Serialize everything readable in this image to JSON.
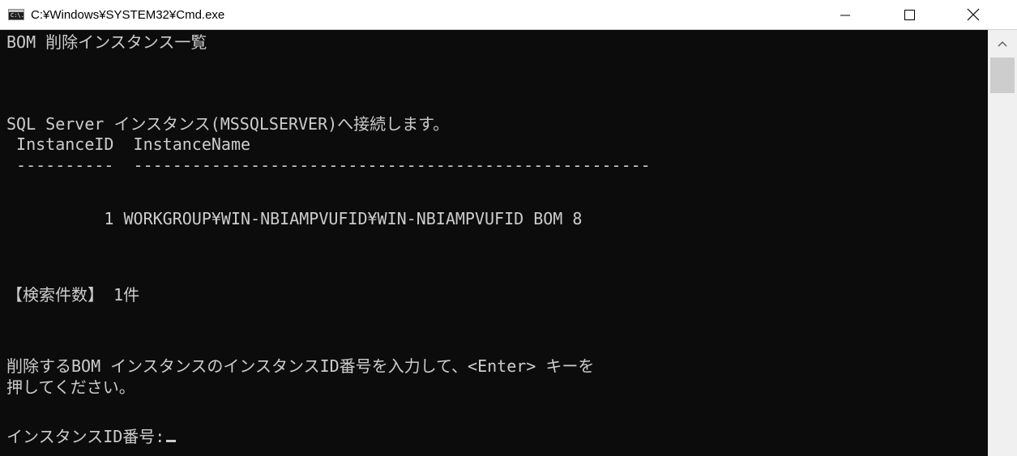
{
  "window": {
    "title": "C:¥Windows¥SYSTEM32¥Cmd.exe",
    "icon": "cmd-icon",
    "icon_text": "C:\\.",
    "controls": {
      "minimize": "minimize-icon",
      "maximize": "maximize-icon",
      "close": "close-icon"
    }
  },
  "console": {
    "background": "#0c0c0c",
    "foreground": "#cccccc",
    "lines": [
      "BOM 削除インスタンス一覧",
      "SQL Server インスタンス(MSSQLSERVER)へ接続します。",
      " InstanceID  InstanceName",
      " ----------  -----------------------------------------------------",
      "          1 WORKGROUP¥WIN-NBIAMPVUFID¥WIN-NBIAMPVUFID BOM 8",
      "【検索件数】 1件",
      "削除するBOM インスタンスのインスタンスID番号を入力して、<Enter> キーを",
      "押してください。",
      "インスタンスID番号:"
    ]
  },
  "scrollbar": {
    "up_icon": "scroll-up-arrow-icon"
  }
}
